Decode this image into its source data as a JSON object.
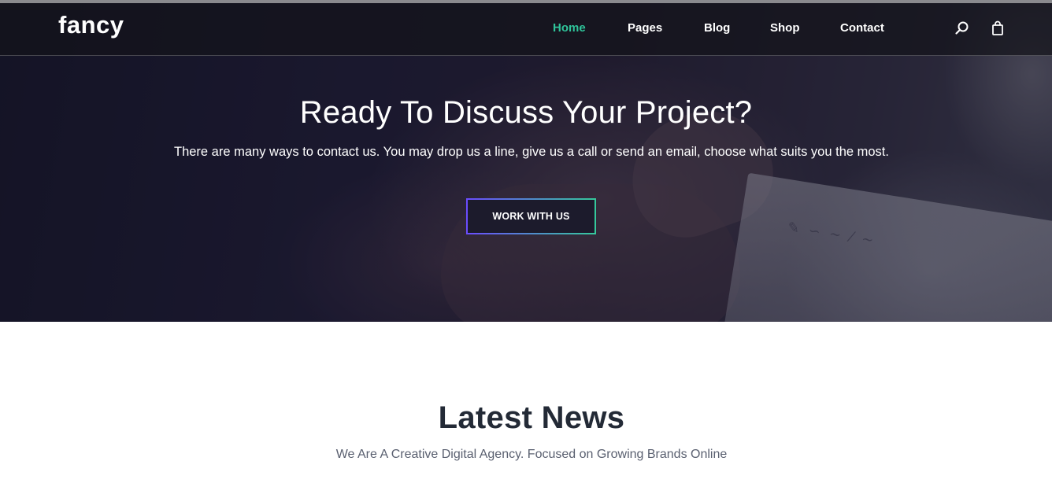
{
  "brand": {
    "logo_text": "fancy"
  },
  "nav": {
    "items": [
      {
        "label": "Home",
        "active": true
      },
      {
        "label": "Pages",
        "active": false
      },
      {
        "label": "Blog",
        "active": false
      },
      {
        "label": "Shop",
        "active": false
      },
      {
        "label": "Contact",
        "active": false
      }
    ],
    "icons": [
      "search-icon",
      "shopping-bag-icon"
    ],
    "active_color": "#2fc49a"
  },
  "hero": {
    "title": "Ready To Discuss Your Project?",
    "subtitle": "There are many ways to contact us. You may drop us a line, give us a call or send an email, choose what suits you the most.",
    "cta_label": "WORK WITH US",
    "cta_gradient": [
      "#6b4cff",
      "#35c99b"
    ]
  },
  "news": {
    "title": "Latest News",
    "subtitle": "We Are A Creative Digital Agency. Focused on Growing Brands Online"
  }
}
